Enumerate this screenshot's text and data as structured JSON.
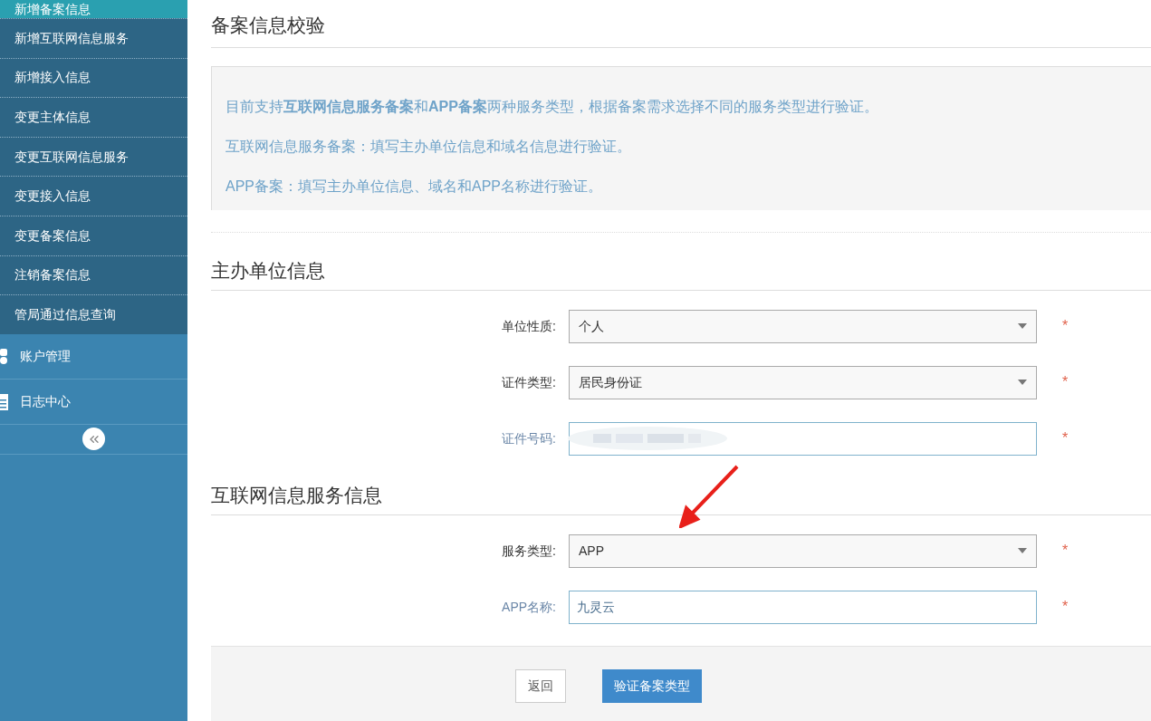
{
  "sidebar": {
    "sub_items": [
      {
        "label": "新增备案信息",
        "selected": true
      },
      {
        "label": "新增互联网信息服务",
        "selected": false
      },
      {
        "label": "新增接入信息",
        "selected": false
      },
      {
        "label": "变更主体信息",
        "selected": false
      },
      {
        "label": "变更互联网信息服务",
        "selected": false
      },
      {
        "label": "变更接入信息",
        "selected": false
      },
      {
        "label": "变更备案信息",
        "selected": false
      },
      {
        "label": "注销备案信息",
        "selected": false
      },
      {
        "label": "管局通过信息查询",
        "selected": false
      }
    ],
    "groups": [
      {
        "label": "账户管理",
        "kind": "account"
      },
      {
        "label": "日志中心",
        "kind": "log"
      }
    ]
  },
  "page_title": "备案信息校验",
  "notice": [
    "目前支持**互联网信息服务备案**和**APP备案**两种服务类型，根据备案需求选择不同的服务类型进行验证。",
    "互联网信息服务备案：填写主办单位信息和域名信息进行验证。",
    "APP备案：填写主办单位信息、域名和APP名称进行验证。"
  ],
  "sections": [
    {
      "title": "主办单位信息",
      "fields": [
        {
          "label": "单位性质:",
          "kind": "select",
          "value": "个人",
          "required_mark": "*"
        },
        {
          "label": "证件类型:",
          "kind": "select",
          "value": "居民身份证",
          "required_mark": "*"
        },
        {
          "label": "证件号码:",
          "kind": "redacted",
          "required_mark": "*"
        }
      ]
    },
    {
      "title": "互联网信息服务信息",
      "fields": [
        {
          "label": "服务类型:",
          "kind": "select",
          "value": "APP",
          "required_mark": "*"
        },
        {
          "label": "APP名称:",
          "kind": "input",
          "value": "九灵云",
          "required_mark": "*"
        }
      ]
    }
  ],
  "buttons": [
    {
      "label": "返回",
      "kind": "secondary"
    },
    {
      "label": "验证备案类型",
      "kind": "primary"
    }
  ]
}
